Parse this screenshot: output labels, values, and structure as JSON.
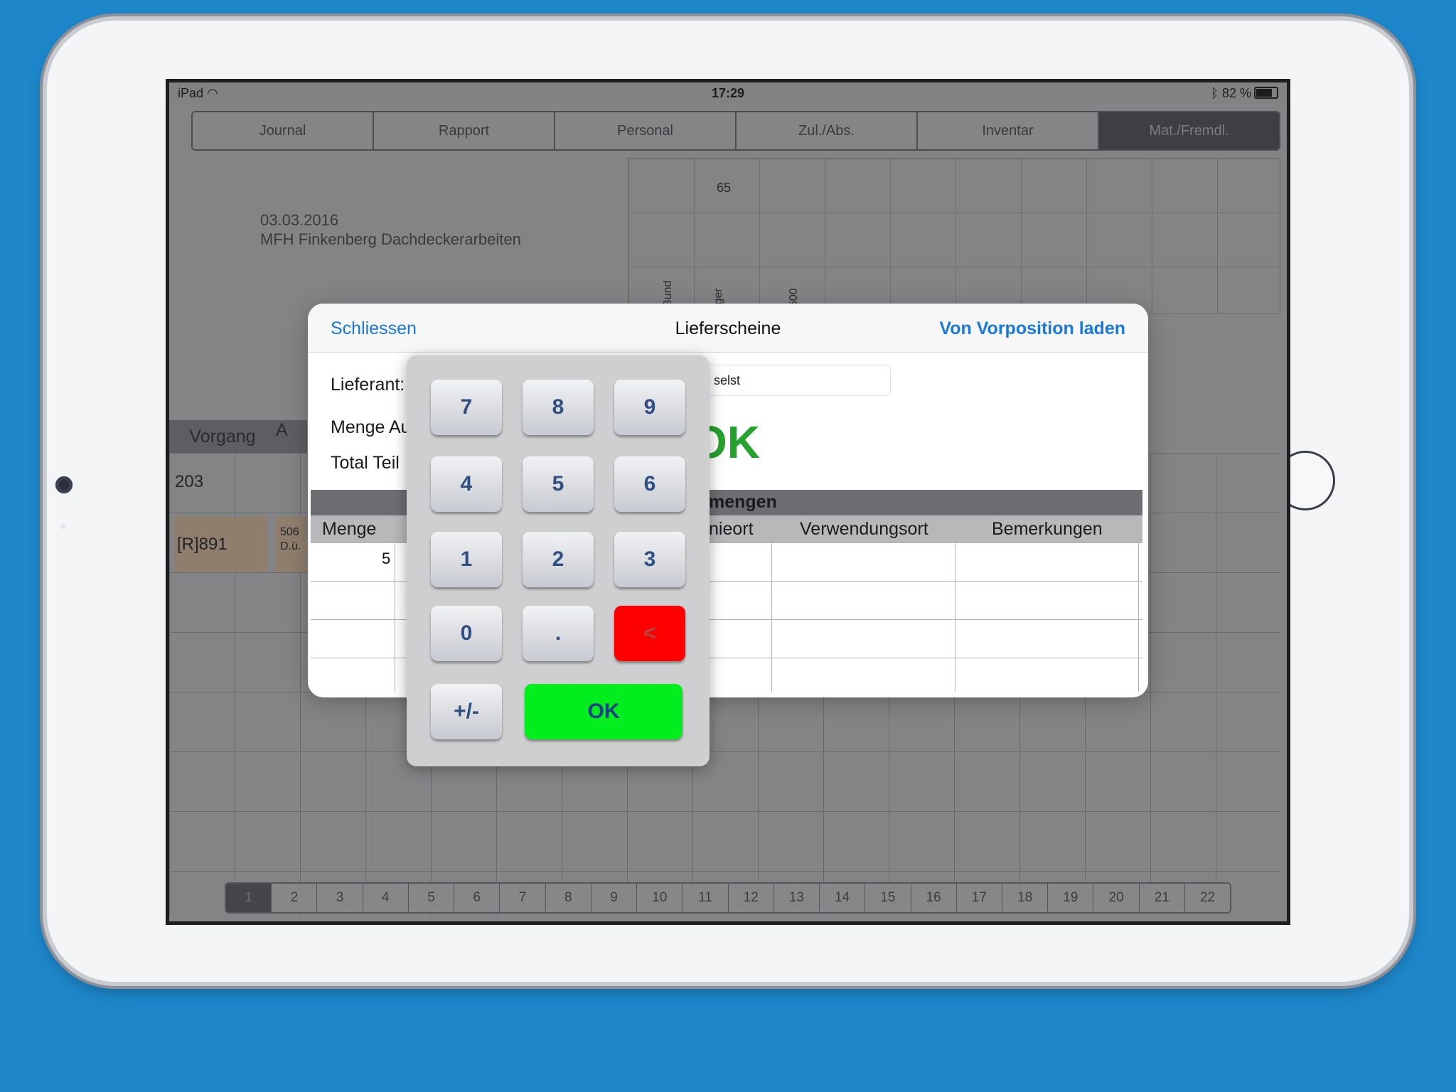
{
  "status": {
    "device": "iPad",
    "time": "17:29",
    "battery": "82 %"
  },
  "tabs": [
    "Journal",
    "Rapport",
    "Personal",
    "Zul./Abs.",
    "Inventar",
    "Mat./Fremdl."
  ],
  "header": {
    "date": "03.03.2016",
    "project": "MFH Finkenberg Dachdeckerarbeiten"
  },
  "grid": {
    "value65": "65",
    "vlabels": [
      "Bund",
      "iger",
      ")",
      "600"
    ]
  },
  "table": {
    "col_vorgang": "Vorgang",
    "col_next": "A",
    "row1": "203",
    "row2": "[R]891",
    "row2b_line1": "506",
    "row2b_line2": "D.ü."
  },
  "pager": [
    "1",
    "2",
    "3",
    "4",
    "5",
    "6",
    "7",
    "8",
    "9",
    "10",
    "11",
    "12",
    "13",
    "14",
    "15",
    "16",
    "17",
    "18",
    "19",
    "20",
    "21",
    "22"
  ],
  "modal": {
    "close": "Schliessen",
    "title": "Lieferscheine",
    "load": "Von Vorposition laden",
    "lieferant_label": "Lieferant:",
    "menge_label": "Menge Au",
    "total_label": "Total Teil",
    "lieferant_value": "selst",
    "big_ok": "OK",
    "section": "mengen",
    "columns": {
      "menge": "Menge",
      "montageort": "nieort",
      "verwendungsort": "Verwendungsort",
      "bemerkungen": "Bemerkungen"
    },
    "first_qty": "5"
  },
  "keypad": {
    "keys": [
      "7",
      "8",
      "9",
      "4",
      "5",
      "6",
      "1",
      "2",
      "3",
      "0",
      "."
    ],
    "back": "<",
    "plusminus": "+/-",
    "ok": "OK"
  }
}
